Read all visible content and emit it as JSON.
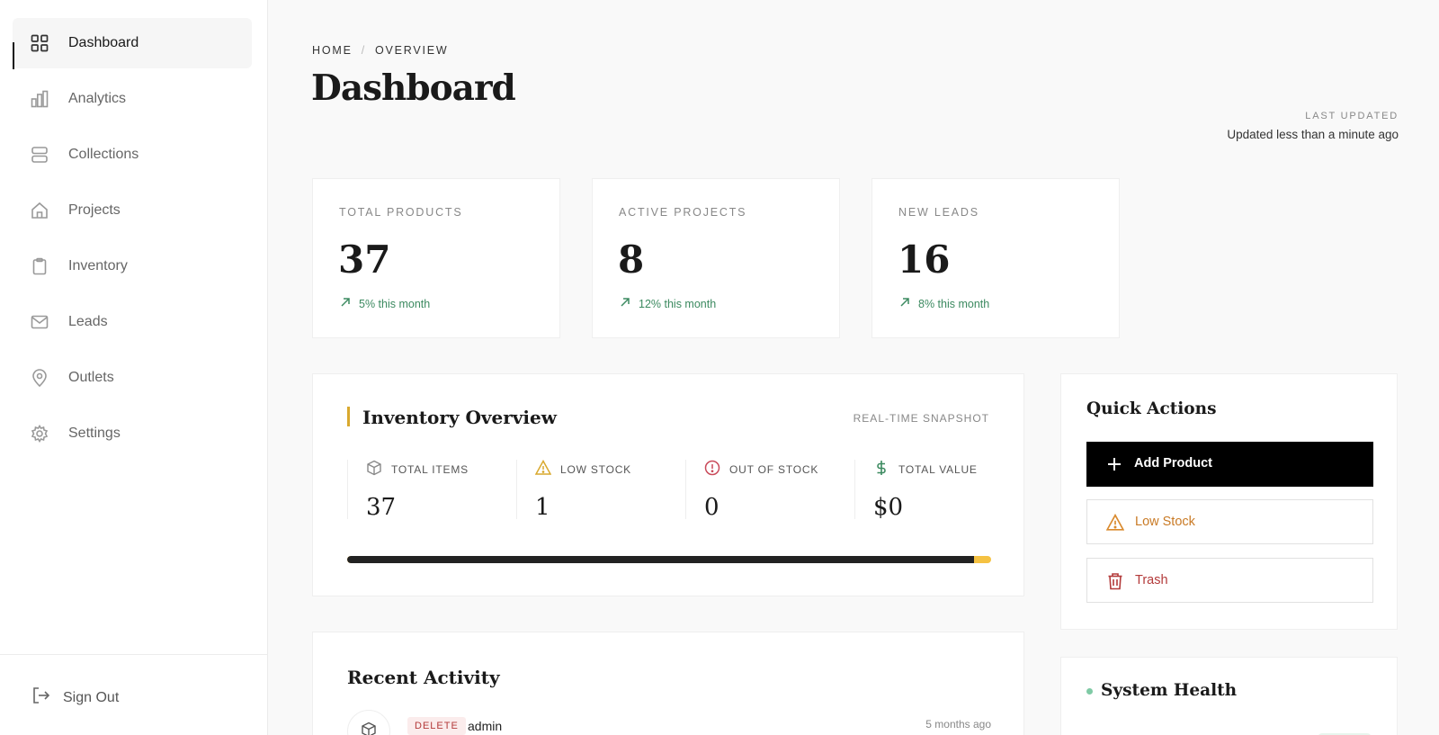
{
  "sidebar": {
    "items": [
      {
        "label": "Dashboard",
        "icon": "grid-icon",
        "active": true
      },
      {
        "label": "Analytics",
        "icon": "bar-chart-icon"
      },
      {
        "label": "Collections",
        "icon": "layers-icon"
      },
      {
        "label": "Projects",
        "icon": "home-icon"
      },
      {
        "label": "Inventory",
        "icon": "clipboard-icon"
      },
      {
        "label": "Leads",
        "icon": "mail-icon"
      },
      {
        "label": "Outlets",
        "icon": "map-pin-icon"
      },
      {
        "label": "Settings",
        "icon": "gear-icon"
      }
    ],
    "signout": "Sign Out"
  },
  "header": {
    "breadcrumb": [
      "HOME",
      "OVERVIEW"
    ],
    "breadcrumb_sep": "/",
    "title": "Dashboard",
    "last_updated_label": "LAST UPDATED",
    "last_updated_value": "Updated less than a minute ago"
  },
  "stats": [
    {
      "label": "TOTAL PRODUCTS",
      "value": "37",
      "trend": "5% this month"
    },
    {
      "label": "ACTIVE PROJECTS",
      "value": "8",
      "trend": "12% this month"
    },
    {
      "label": "NEW LEADS",
      "value": "16",
      "trend": "8% this month"
    }
  ],
  "inventory": {
    "title": "Inventory Overview",
    "tag": "REAL-TIME SNAPSHOT",
    "metrics": [
      {
        "label": "TOTAL ITEMS",
        "value": "37",
        "icon": "box-icon"
      },
      {
        "label": "LOW STOCK",
        "value": "1",
        "icon": "warning-icon"
      },
      {
        "label": "OUT OF STOCK",
        "value": "0",
        "icon": "alert-circle-icon"
      },
      {
        "label": "TOTAL VALUE",
        "value": "$0",
        "icon": "dollar-icon"
      }
    ],
    "in_stock_fraction": 0.973
  },
  "quick_actions": {
    "title": "Quick Actions",
    "add_product": "Add Product",
    "low_stock": "Low Stock",
    "trash": "Trash"
  },
  "recent_activity": {
    "title": "Recent Activity",
    "items": [
      {
        "action": "DELETE",
        "user": "admin",
        "time": "5 months ago"
      }
    ]
  },
  "system_health": {
    "title": "System Health"
  },
  "colors": {
    "accent_gold": "#d9a92e",
    "bar_warning": "#f5c242",
    "success": "#3c8a60",
    "warning": "#c97a25",
    "danger": "#b33a3a"
  }
}
